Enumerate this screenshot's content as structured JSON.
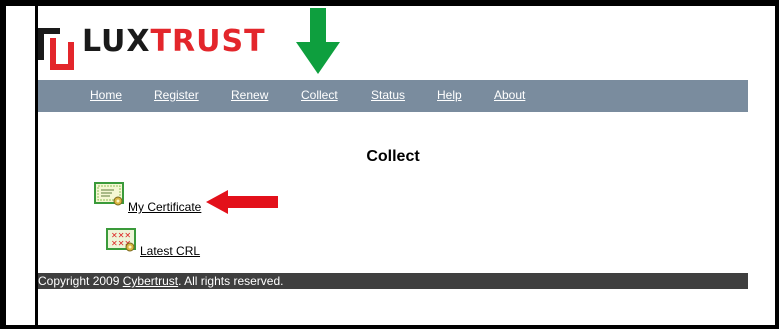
{
  "brand": {
    "logo_part1": "LUX",
    "logo_part2": "TRUST"
  },
  "nav": {
    "items": [
      {
        "label": "Home"
      },
      {
        "label": "Register"
      },
      {
        "label": "Renew"
      },
      {
        "label": "Collect"
      },
      {
        "label": "Status"
      },
      {
        "label": "Help"
      },
      {
        "label": "About"
      }
    ]
  },
  "main": {
    "title": "Collect",
    "links": [
      {
        "label": "My Certificate",
        "icon": "certificate-icon"
      },
      {
        "label": "Latest CRL",
        "icon": "crl-icon"
      }
    ]
  },
  "footer": {
    "prefix": "Copyright 2009 ",
    "link": "Cybertrust",
    "suffix": ". All rights reserved."
  },
  "annotations": {
    "arrow_green_color": "#0e9f3e",
    "arrow_red_color": "#e3101a",
    "nav_bg": "#7a8c9e"
  }
}
